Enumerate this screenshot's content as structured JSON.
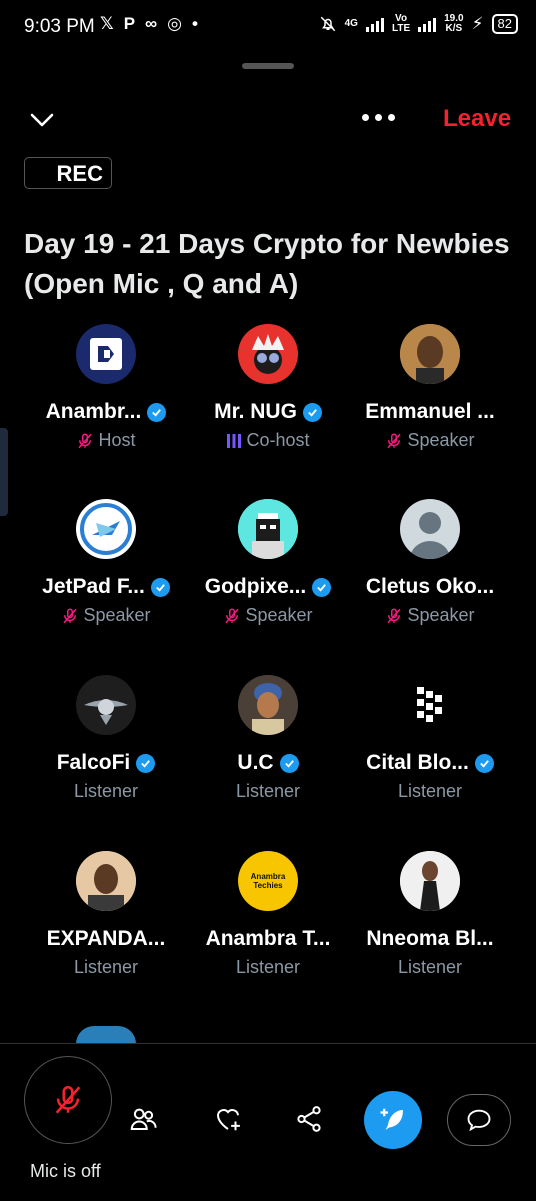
{
  "status_bar": {
    "time": "9:03 PM",
    "net_top": "4G",
    "vo": "Vo",
    "lte": "LTE",
    "speed_top": "19.0",
    "speed_unit": "K/S",
    "battery": "82"
  },
  "header": {
    "leave_label": "Leave",
    "rec_label": "REC",
    "title": "Day 19 - 21 Days Crypto for Newbies (Open Mic , Q and A)"
  },
  "participants": [
    {
      "name": "Anambr...",
      "verified": true,
      "role": "Host",
      "mic": "muted"
    },
    {
      "name": "Mr. NUG",
      "verified": true,
      "role": "Co-host",
      "mic": "speaking"
    },
    {
      "name": "Emmanuel ...",
      "verified": false,
      "role": "Speaker",
      "mic": "muted"
    },
    {
      "name": "JetPad F...",
      "verified": true,
      "role": "Speaker",
      "mic": "muted"
    },
    {
      "name": "Godpixe...",
      "verified": true,
      "role": "Speaker",
      "mic": "muted"
    },
    {
      "name": "Cletus Oko...",
      "verified": false,
      "role": "Speaker",
      "mic": "muted"
    },
    {
      "name": "FalcoFi",
      "verified": true,
      "role": "Listener",
      "mic": "none"
    },
    {
      "name": "U.C",
      "verified": true,
      "role": "Listener",
      "mic": "none"
    },
    {
      "name": "Cital Blo...",
      "verified": true,
      "role": "Listener",
      "mic": "none"
    },
    {
      "name": "EXPANDA...",
      "verified": false,
      "role": "Listener",
      "mic": "none"
    },
    {
      "name": "Anambra T...",
      "verified": false,
      "role": "Listener",
      "mic": "none"
    },
    {
      "name": "Nneoma Bl...",
      "verified": false,
      "role": "Listener",
      "mic": "none"
    }
  ],
  "avatar_text": {
    "anambra_techies_line1": "Anambra",
    "anambra_techies_line2": "Techies"
  },
  "bottom_bar": {
    "mic_label": "Mic is off"
  },
  "colors": {
    "accent": "#1d9bf0",
    "leave": "#f4212e",
    "muted_mic": "#f91880",
    "speaking": "#7856ff",
    "background": "#000000"
  }
}
